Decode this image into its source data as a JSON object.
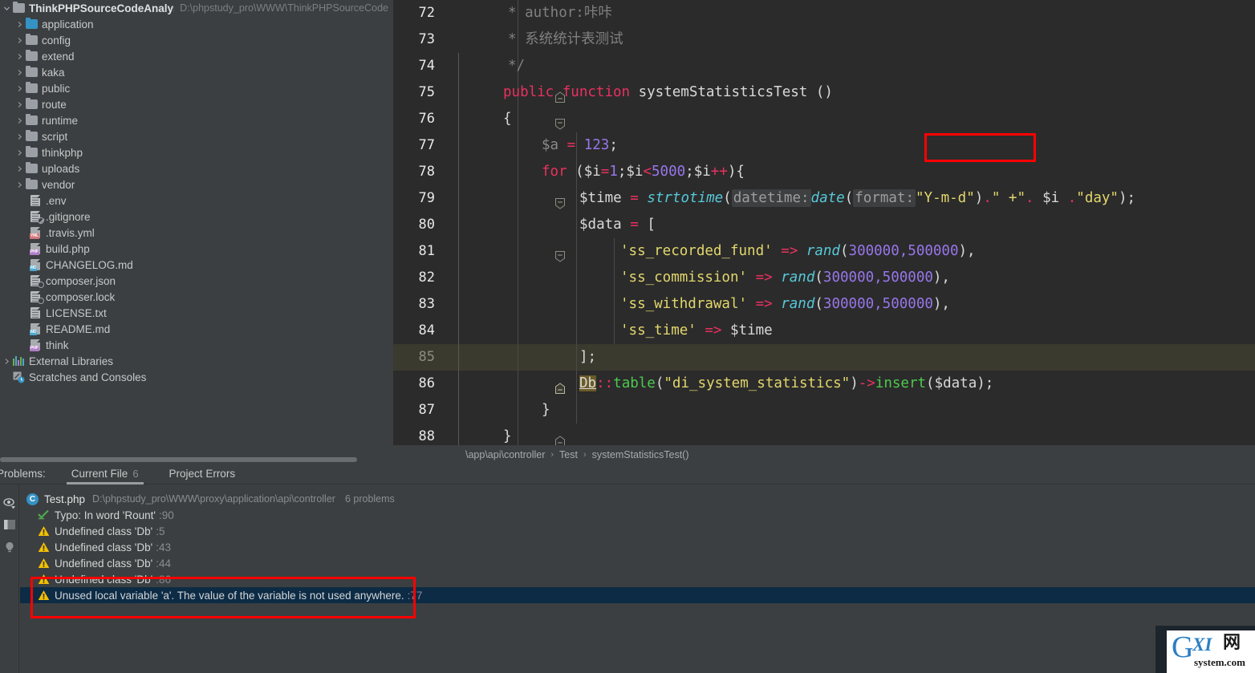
{
  "project_tree": {
    "root": {
      "label": "ThinkPHPSourceCodeAnalysis",
      "path": "D:\\phpstudy_pro\\WWW\\ThinkPHPSourceCode",
      "icon": "folder-icon",
      "expanded": true
    },
    "folders": [
      {
        "label": "application",
        "icon": "folder-icon",
        "accent": "#3592c4"
      },
      {
        "label": "config",
        "icon": "folder-icon"
      },
      {
        "label": "extend",
        "icon": "folder-icon"
      },
      {
        "label": "kaka",
        "icon": "folder-icon"
      },
      {
        "label": "public",
        "icon": "folder-icon"
      },
      {
        "label": "route",
        "icon": "folder-icon"
      },
      {
        "label": "runtime",
        "icon": "folder-icon"
      },
      {
        "label": "script",
        "icon": "folder-icon"
      },
      {
        "label": "thinkphp",
        "icon": "folder-icon"
      },
      {
        "label": "uploads",
        "icon": "folder-icon"
      },
      {
        "label": "vendor",
        "icon": "folder-icon"
      }
    ],
    "files": [
      {
        "label": ".env",
        "icon": "text-file-icon",
        "kind": "txt"
      },
      {
        "label": ".gitignore",
        "icon": "gitignore-file-icon",
        "kind": "git"
      },
      {
        "label": ".travis.yml",
        "icon": "yml-file-icon",
        "kind": "yml",
        "tag": "YML"
      },
      {
        "label": "build.php",
        "icon": "php-file-icon",
        "kind": "php",
        "tag": "PHP"
      },
      {
        "label": "CHANGELOG.md",
        "icon": "markdown-file-icon",
        "kind": "md",
        "tag": "MD"
      },
      {
        "label": "composer.json",
        "icon": "json-file-icon",
        "kind": "json"
      },
      {
        "label": "composer.lock",
        "icon": "json-file-icon",
        "kind": "json"
      },
      {
        "label": "LICENSE.txt",
        "icon": "text-file-icon",
        "kind": "txt"
      },
      {
        "label": "README.md",
        "icon": "markdown-file-icon",
        "kind": "md",
        "tag": "MD"
      },
      {
        "label": "think",
        "icon": "php-file-icon",
        "kind": "php",
        "tag": "PHP"
      }
    ],
    "extras": [
      {
        "label": "External Libraries",
        "icon": "external-libraries-icon",
        "expandable": true
      },
      {
        "label": "Scratches and Consoles",
        "icon": "scratches-icon",
        "expandable": false
      }
    ]
  },
  "editor": {
    "lines": [
      {
        "num": "72",
        "fold": "none",
        "indent_guides": [
          155
        ],
        "highlight": false
      },
      {
        "num": "73",
        "fold": "none",
        "indent_guides": [
          155
        ],
        "highlight": false
      },
      {
        "num": "74",
        "fold": "end",
        "indent_guides": [
          155
        ],
        "highlight": false
      },
      {
        "num": "75",
        "fold": "start",
        "indent_guides": [
          155
        ],
        "highlight": false
      },
      {
        "num": "76",
        "fold": "none",
        "indent_guides": [
          155
        ],
        "highlight": false
      },
      {
        "num": "77",
        "fold": "none",
        "indent_guides": [
          155,
          228
        ],
        "highlight": false
      },
      {
        "num": "78",
        "fold": "start",
        "indent_guides": [
          155,
          228
        ],
        "highlight": false
      },
      {
        "num": "79",
        "fold": "none",
        "indent_guides": [
          155,
          228,
          275
        ],
        "highlight": false
      },
      {
        "num": "80",
        "fold": "start",
        "indent_guides": [
          155,
          228,
          275
        ],
        "highlight": false
      },
      {
        "num": "81",
        "fold": "none",
        "indent_guides": [
          155,
          228,
          275
        ],
        "highlight": false
      },
      {
        "num": "82",
        "fold": "none",
        "indent_guides": [
          155,
          228,
          275
        ],
        "highlight": false
      },
      {
        "num": "83",
        "fold": "none",
        "indent_guides": [
          155,
          228,
          275
        ],
        "highlight": false
      },
      {
        "num": "84",
        "fold": "none",
        "indent_guides": [
          155,
          228,
          275
        ],
        "highlight": false
      },
      {
        "num": "85",
        "fold": "end",
        "indent_guides": [
          155,
          228,
          275
        ],
        "highlight": true
      },
      {
        "num": "86",
        "fold": "none",
        "indent_guides": [
          155,
          228
        ],
        "highlight": false
      },
      {
        "num": "87",
        "fold": "end",
        "indent_guides": [
          155,
          228
        ],
        "highlight": false
      },
      {
        "num": "88",
        "fold": "end",
        "indent_guides": [
          155
        ],
        "highlight": false
      }
    ],
    "code_text": {
      "l72": "* author:咔咔",
      "l73": "* 系统统计表测试",
      "l74": "*/",
      "l75_kw1": "public",
      "l75_kw2": "function",
      "l75_name": "systemStatisticsTest",
      "l75_parens": "()",
      "l76": "{",
      "l77_var": "$a",
      "l77_eq": "=",
      "l77_num": "123",
      "l77_semi": ";",
      "l78_for": "for",
      "l78_open": "($i",
      "l78_eq": "=",
      "l78_one": "1",
      "l78_semi1": ";$i",
      "l78_lt": "<",
      "l78_5000": "5000",
      "l78_semi2": ";$i",
      "l78_plusplus": "++",
      "l78_close": "){",
      "l79_var": "$time",
      "l79_eq": "=",
      "l79_fn1": "strtotime",
      "l79_p1": "(",
      "l79_hint1": "datetime:",
      "l79_fn2": "date",
      "l79_p2": "(",
      "l79_hint2": "format:",
      "l79_str1": "\"Y-m-d\"",
      "l79_p3": ")",
      "l79_dot1": ".",
      "l79_str2": "\" +\"",
      "l79_dot2": ".",
      "l79_var2": "$i",
      "l79_dot3": ".",
      "l79_str3": "\"day\"",
      "l79_end": ");",
      "l80_var": "$data",
      "l80_eq": "=",
      "l80_br": "[",
      "l81_key": "'ss_recorded_fund'",
      "l81_arrow": "=>",
      "l81_fn": "rand",
      "l81_args": "300000,500000",
      "l82_key": "'ss_commission'",
      "l82_arrow": "=>",
      "l82_fn": "rand",
      "l82_args": "300000,500000",
      "l83_key": "'ss_withdrawal'",
      "l83_arrow": "=>",
      "l83_fn": "rand",
      "l83_args": "300000,500000",
      "l84_key": "'ss_time'",
      "l84_arrow": "=>",
      "l84_val": "$time",
      "l85": "];",
      "l86_db": "Db",
      "l86_colons": "::",
      "l86_table": "table",
      "l86_p1": "(",
      "l86_str": "\"di_system_statistics\"",
      "l86_p2": ")",
      "l86_arrow": "->",
      "l86_insert": "insert",
      "l86_p3": "(",
      "l86_data": "$data",
      "l86_p4": ");",
      "l87": "}",
      "l88": "}"
    },
    "annotation_box_color": "#ff0000",
    "highlight_line": "85",
    "breadcrumb": {
      "items": [
        "\\app\\api\\controller",
        "Test",
        "systemStatisticsTest()"
      ],
      "separator": "›"
    }
  },
  "problems_panel": {
    "title": "Problems:",
    "tabs": [
      {
        "label": "Current File",
        "count": "6",
        "active": true
      },
      {
        "label": "Project Errors",
        "count": "",
        "active": false
      }
    ],
    "file_group": {
      "badge": "C",
      "name": "Test.php",
      "path": "D:\\phpstudy_pro\\WWW\\proxy\\application\\api\\controller",
      "count": "6 problems"
    },
    "issues": [
      {
        "icon": "typo-icon",
        "text": "Typo: In word 'Rount'",
        "line": ":90",
        "selected": false
      },
      {
        "icon": "warning-icon",
        "text": "Undefined class 'Db'",
        "line": ":5",
        "selected": false
      },
      {
        "icon": "warning-icon",
        "text": "Undefined class 'Db'",
        "line": ":43",
        "selected": false
      },
      {
        "icon": "warning-icon",
        "text": "Undefined class 'Db'",
        "line": ":44",
        "selected": false
      },
      {
        "icon": "warning-icon",
        "text": "Undefined class 'Db'",
        "line": ":86",
        "selected": false
      },
      {
        "icon": "warning-icon",
        "text": "Unused local variable 'a'. The value of the variable is not used anywhere.",
        "line": ":77",
        "selected": true
      }
    ],
    "toolbar_icons": [
      "inspection-eye-icon",
      "layout-panel-icon",
      "lightbulb-icon"
    ],
    "selected_row_color": "#0d2b45"
  },
  "watermark": {
    "g": "G",
    "xi": "XI",
    "cn": "网",
    "domain": "system.com"
  }
}
